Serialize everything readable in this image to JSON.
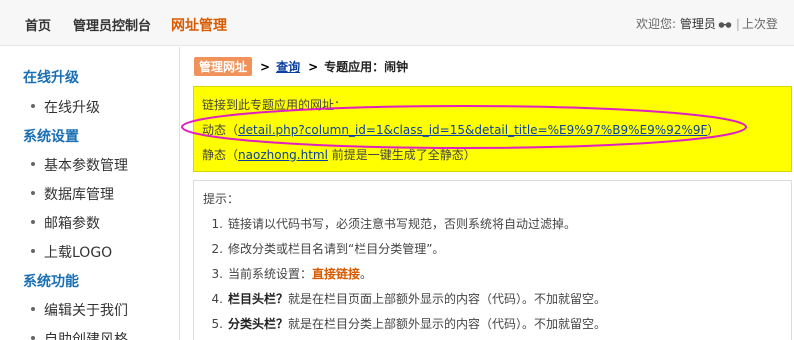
{
  "topnav": {
    "home": "首页",
    "admin": "管理员控制台",
    "url_manage": "网址管理"
  },
  "topright": {
    "welcome": "欢迎您: ",
    "user": "管理员",
    "sep": "|",
    "last_login": "上次登"
  },
  "sidebar": {
    "head1": "在线升级",
    "item1": "在线升级",
    "head2": "系统设置",
    "item2": "基本参数管理",
    "item3": "数据库管理",
    "item4": "邮箱参数",
    "item5": "上载LOGO",
    "head3": "系统功能",
    "item6": "编辑关于我们",
    "item7": "自助创建风格"
  },
  "crumb": {
    "tag": "管理网址",
    "arrow1": ">",
    "query": "查询",
    "arrow2": ">",
    "current": "专题应用：闹钟"
  },
  "yellow": {
    "line1": "链接到此专题应用的网址：",
    "dyn_prefix": "动态（",
    "dyn_link": "detail.php?column_id=1&class_id=15&detail_title=%E9%97%B9%E9%92%9F",
    "dyn_suffix": "）",
    "static_prefix": "静态（",
    "static_link": "naozhong.html",
    "static_suffix": " 前提是一键生成了全静态）"
  },
  "tips": {
    "title": "提示：",
    "r1_num": "1.",
    "r1_text": "链接请以代码书写，必须注意书写规范，否则系统将自动过滤掉。",
    "r2_num": "2.",
    "r2_text": "修改分类或栏目名请到“栏目分类管理”。",
    "r3_num": "3.",
    "r3_text": "当前系统设置：",
    "r3_value": "直接链接",
    "r3_end": "。",
    "r4_num": "4.",
    "r4_bold": "栏目头栏？",
    "r4_text": "就是在栏目页面上部额外显示的内容（代码）。不加就留空。",
    "r5_num": "5.",
    "r5_bold": "分类头栏？",
    "r5_text": "就是在栏目分类上部额外显示的内容（代码）。不加就留空。"
  },
  "colors": {
    "highlight_ellipse": "#e020c0",
    "yellow_bg": "#ffff00",
    "nav_active": "#d95b00",
    "sidebar_head": "#1a6fb5",
    "link": "#0a3fa3"
  }
}
